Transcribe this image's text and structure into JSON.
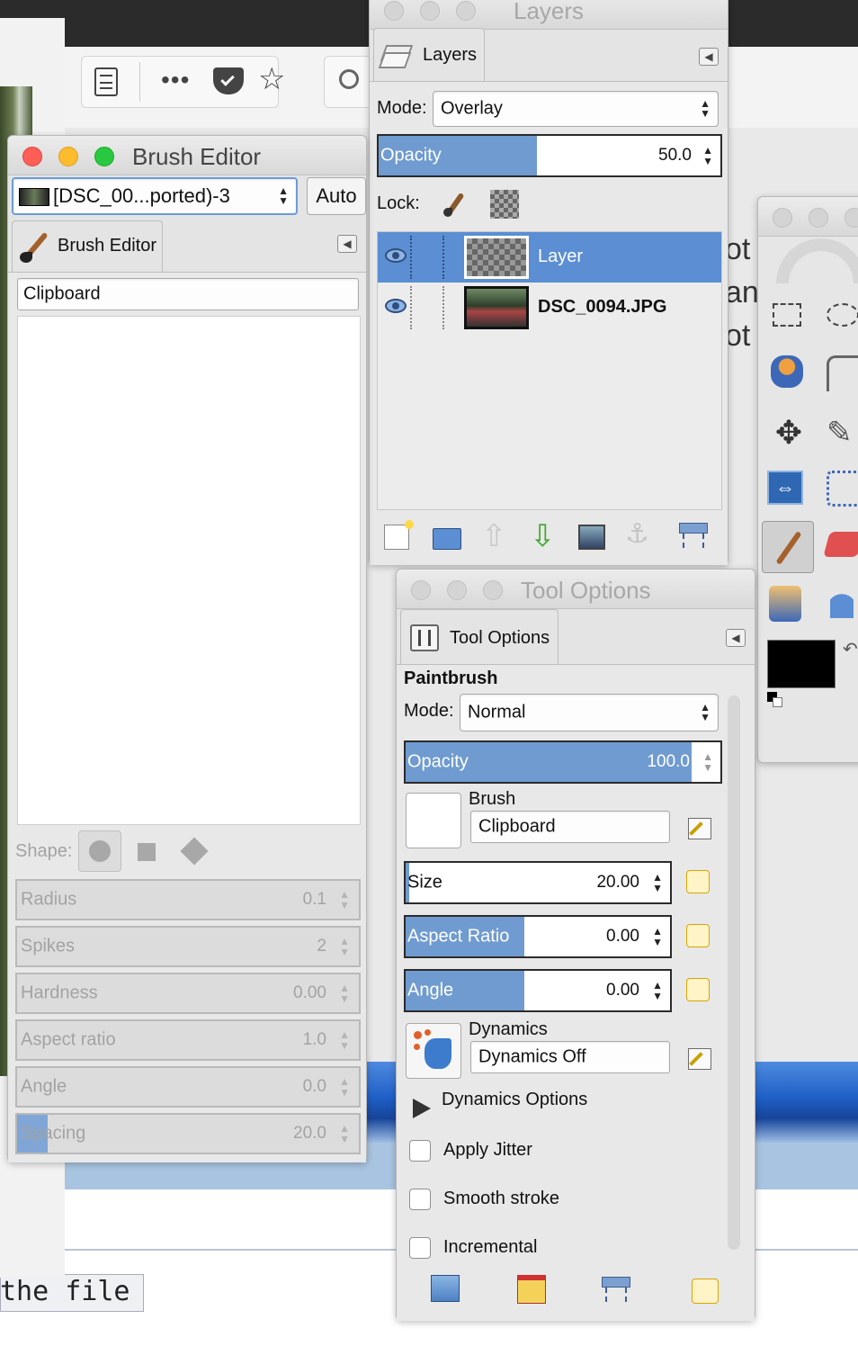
{
  "background": {
    "file_text": "the file",
    "partial_texts": [
      "ot",
      "an",
      "ot"
    ]
  },
  "brush_editor": {
    "window_title": "Brush Editor",
    "image_selector": "[DSC_00...ported)-3",
    "auto_button": "Auto",
    "tab_label": "Brush Editor",
    "brush_name": "Clipboard",
    "shape_label": "Shape:",
    "params": [
      {
        "label": "Radius",
        "value": "0.1"
      },
      {
        "label": "Spikes",
        "value": "2"
      },
      {
        "label": "Hardness",
        "value": "0.00"
      },
      {
        "label": "Aspect ratio",
        "value": "1.0"
      },
      {
        "label": "Angle",
        "value": "0.0"
      },
      {
        "label": "Spacing",
        "value": "20.0"
      }
    ]
  },
  "layers": {
    "window_title": "Layers",
    "tab_label": "Layers",
    "mode_label": "Mode:",
    "mode_value": "Overlay",
    "opacity_label": "Opacity",
    "opacity_value": "50.0",
    "lock_label": "Lock:",
    "items": [
      {
        "name": "Layer",
        "selected": true
      },
      {
        "name": "DSC_0094.JPG",
        "selected": false
      }
    ]
  },
  "tool_options": {
    "window_title": "Tool Options",
    "tab_label": "Tool Options",
    "tool_name": "Paintbrush",
    "mode_label": "Mode:",
    "mode_value": "Normal",
    "opacity_label": "Opacity",
    "opacity_value": "100.0",
    "brush_label": "Brush",
    "brush_value": "Clipboard",
    "size_label": "Size",
    "size_value": "20.00",
    "aspect_label": "Aspect Ratio",
    "aspect_value": "0.00",
    "angle_label": "Angle",
    "angle_value": "0.00",
    "dynamics_label": "Dynamics",
    "dynamics_value": "Dynamics Off",
    "dynamics_options": "Dynamics Options",
    "apply_jitter": "Apply Jitter",
    "smooth_stroke": "Smooth stroke",
    "incremental": "Incremental"
  },
  "colors": {
    "accent_blue": "#6f9bd0",
    "selected_row": "#5b8ed2",
    "foreground": "#000000",
    "background": "#ffffff"
  }
}
